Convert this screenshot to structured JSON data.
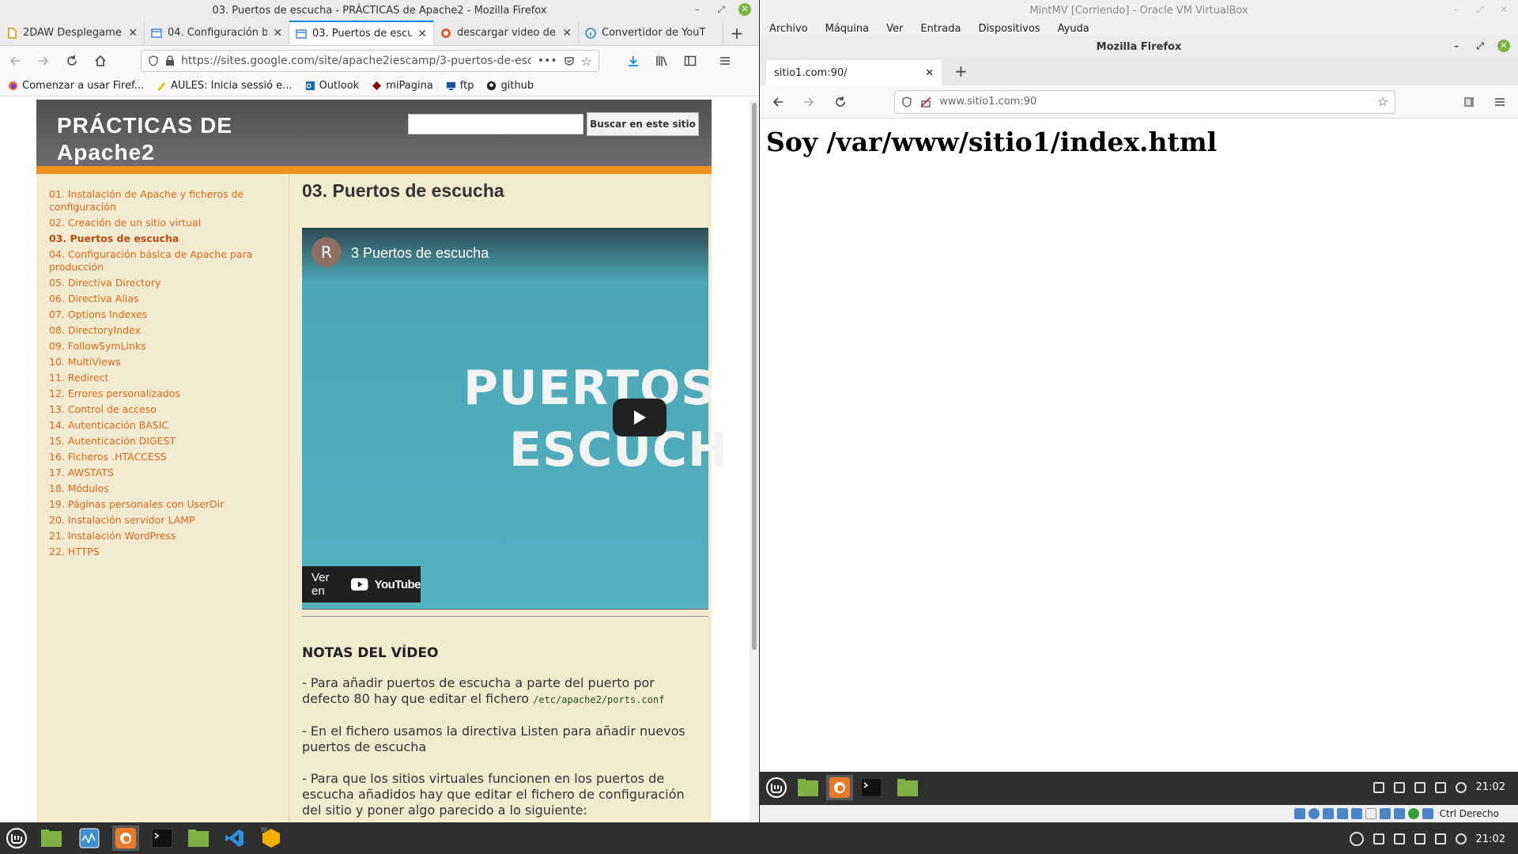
{
  "left_browser": {
    "window_title": "03. Puertos de escucha - PRÁCTICAS de Apache2 - Mozilla Firefox",
    "tabs": [
      {
        "label": "2DAW Desplegamen",
        "icon": "document-icon"
      },
      {
        "label": "04. Configuración bá",
        "icon": "sites-icon"
      },
      {
        "label": "03. Puertos de escuc",
        "icon": "sites-icon",
        "active": true
      },
      {
        "label": "descargar video de y",
        "icon": "duckduckgo-icon"
      },
      {
        "label": "Convertidor de YouT",
        "icon": "info-icon"
      }
    ],
    "url": "https://sites.google.com/site/apache2iescamp/3-puertos-de-escucha",
    "bookmarks": [
      {
        "label": "Comenzar a usar Firef...",
        "icon": "firefox-icon"
      },
      {
        "label": "AULES: Inicia sessió e...",
        "icon": "aules-icon"
      },
      {
        "label": "Outlook",
        "icon": "outlook-icon"
      },
      {
        "label": "miPagina",
        "icon": "mipagina-icon"
      },
      {
        "label": "ftp",
        "icon": "ftp-icon"
      },
      {
        "label": "github",
        "icon": "github-icon"
      }
    ]
  },
  "site": {
    "title": "PRÁCTICAS DE Apache2",
    "search_button": "Buscar en este sitio",
    "search_value": "",
    "nav": [
      "01. Instalación de Apache y ficheros de configuración",
      "02. Creación de un sitio virtual",
      "03. Puertos de escucha",
      "04. Configuración básica de Apache para producción",
      "05. Directiva Directory",
      "06. Directiva Alias",
      "07. Options Indexes",
      "08. DirectoryIndex",
      "09. FollowSymLinks",
      "10. MultiViews",
      "11. Redirect",
      "12. Errores personalizados",
      "13. Control de acceso",
      "14. Autenticación BASIC",
      "15. Autenticación DIGEST",
      "16. Ficheros .HTACCESS",
      "17. AWSTATS",
      "18. Módulos",
      "19. Páginas personales con UserDir",
      "20. Instalación servidor LAMP",
      "21. Instalación WordPress",
      "22. HTTPS"
    ],
    "current_index": 2,
    "page_heading": "03. Puertos de escucha",
    "video": {
      "avatar_letter": "R",
      "title": "3 Puertos de escucha",
      "overlay_line1": "PUERTOS",
      "overlay_line2": "ESCUCH",
      "watch_on": "Ver en",
      "youtube": "YouTube"
    },
    "notes_heading": "NOTAS DEL VÍDEO",
    "notes": [
      {
        "text": "- Para añadir puertos de escucha a parte del puerto por defecto 80 hay que editar el fichero ",
        "code": "/etc/apache2/ports.conf"
      },
      {
        "text": "- En el fichero usamos la directiva Listen para añadir nuevos puertos de escucha",
        "code": ""
      },
      {
        "text": "- Para que los sitios virtuales funcionen en los puertos de escucha añadidos hay que editar el fichero de configuración del sitio y poner algo parecido a lo siguiente:",
        "code": ""
      }
    ]
  },
  "virtualbox": {
    "window_title": "MintMV [Corriendo] - Oracle VM VirtualBox",
    "menu": [
      "Archivo",
      "Máquina",
      "Ver",
      "Entrada",
      "Dispositivos",
      "Ayuda"
    ],
    "vm_window_title": "Mozilla Firefox",
    "vm_tab": "sitio1.com:90/",
    "vm_url": "www.sitio1.com:90",
    "vm_body": "Soy /var/www/sitio1/index.html",
    "vm_clock": "21:02",
    "host_key": "Ctrl Derecho"
  },
  "host": {
    "clock": "21:02"
  },
  "colors": {
    "accent_tab": "#0a84ff",
    "site_orange": "#f29120",
    "site_link": "#e06a1a",
    "site_bg": "#f3ebd0",
    "video_teal": "#53b1c0",
    "taskbar": "#2f2f2f"
  }
}
